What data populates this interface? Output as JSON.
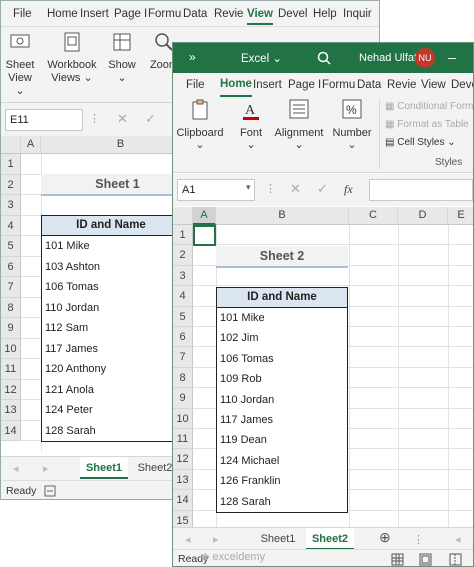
{
  "colors": {
    "excel_green": "#217346",
    "ribbon_bg": "#f3f3f3",
    "table_header_bg": "#dce6f1",
    "title_underline": "#a8bfdc"
  },
  "window1": {
    "tabs": [
      "File",
      "Home",
      "Insert",
      "Page I",
      "Formu",
      "Data",
      "Revie",
      "View",
      "Devel",
      "Help",
      "Inquir"
    ],
    "active_tab": "View",
    "ribbon": [
      {
        "label1": "Sheet",
        "label2": "View",
        "icon": "sheet-view-icon"
      },
      {
        "label1": "Workbook",
        "label2": "Views",
        "icon": "workbook-views-icon"
      },
      {
        "label1": "Show",
        "label2": "",
        "icon": "show-icon"
      },
      {
        "label1": "Zoom",
        "label2": "",
        "icon": "zoom-icon"
      }
    ],
    "name_box": "E11",
    "columns": [
      "A",
      "B"
    ],
    "rows": [
      "1",
      "2",
      "3",
      "4",
      "5",
      "6",
      "7",
      "8",
      "9",
      "10",
      "11",
      "12",
      "13",
      "14"
    ],
    "title": "Sheet 1",
    "table_header": "ID and Name",
    "entries": [
      "101 Mike",
      "103 Ashton",
      "106 Tomas",
      "110 Jordan",
      "112 Sam",
      "117 James",
      "120 Anthony",
      "121 Anola",
      "124 Peter",
      "128 Sarah"
    ],
    "sheet_tabs": [
      "Sheet1",
      "Sheet2"
    ],
    "active_sheet": "Sheet1",
    "status": "Ready"
  },
  "window2": {
    "title_bar": {
      "app_name": "Excel",
      "user_name": "Nehad Ulfat",
      "initials": "NU"
    },
    "tabs": [
      "File",
      "Home",
      "Insert",
      "Page I",
      "Formu",
      "Data",
      "Revie",
      "View",
      "Devel"
    ],
    "active_tab": "Home",
    "ribbon": {
      "clipboard": "Clipboard",
      "font": "Font",
      "alignment": "Alignment",
      "number": "Number",
      "conditional_formatting": "Conditional Forma",
      "format_as_table": "Format as Table",
      "cell_styles": "Cell Styles",
      "styles_group": "Styles"
    },
    "name_box": "A1",
    "fx": "fx",
    "columns": [
      "A",
      "B",
      "C",
      "D",
      "E"
    ],
    "rows": [
      "1",
      "2",
      "3",
      "4",
      "5",
      "6",
      "7",
      "8",
      "9",
      "10",
      "11",
      "12",
      "13",
      "14",
      "15"
    ],
    "title": "Sheet 2",
    "table_header": "ID and Name",
    "entries": [
      "101 Mike",
      "102 Jim",
      "106 Tomas",
      "109 Rob",
      "110 Jordan",
      "117 James",
      "119 Dean",
      "124 Michael",
      "126 Franklin",
      "128 Sarah"
    ],
    "sheet_tabs": [
      "Sheet1",
      "Sheet2"
    ],
    "active_sheet": "Sheet2",
    "status": "Ready",
    "watermark": "exceldemy"
  }
}
